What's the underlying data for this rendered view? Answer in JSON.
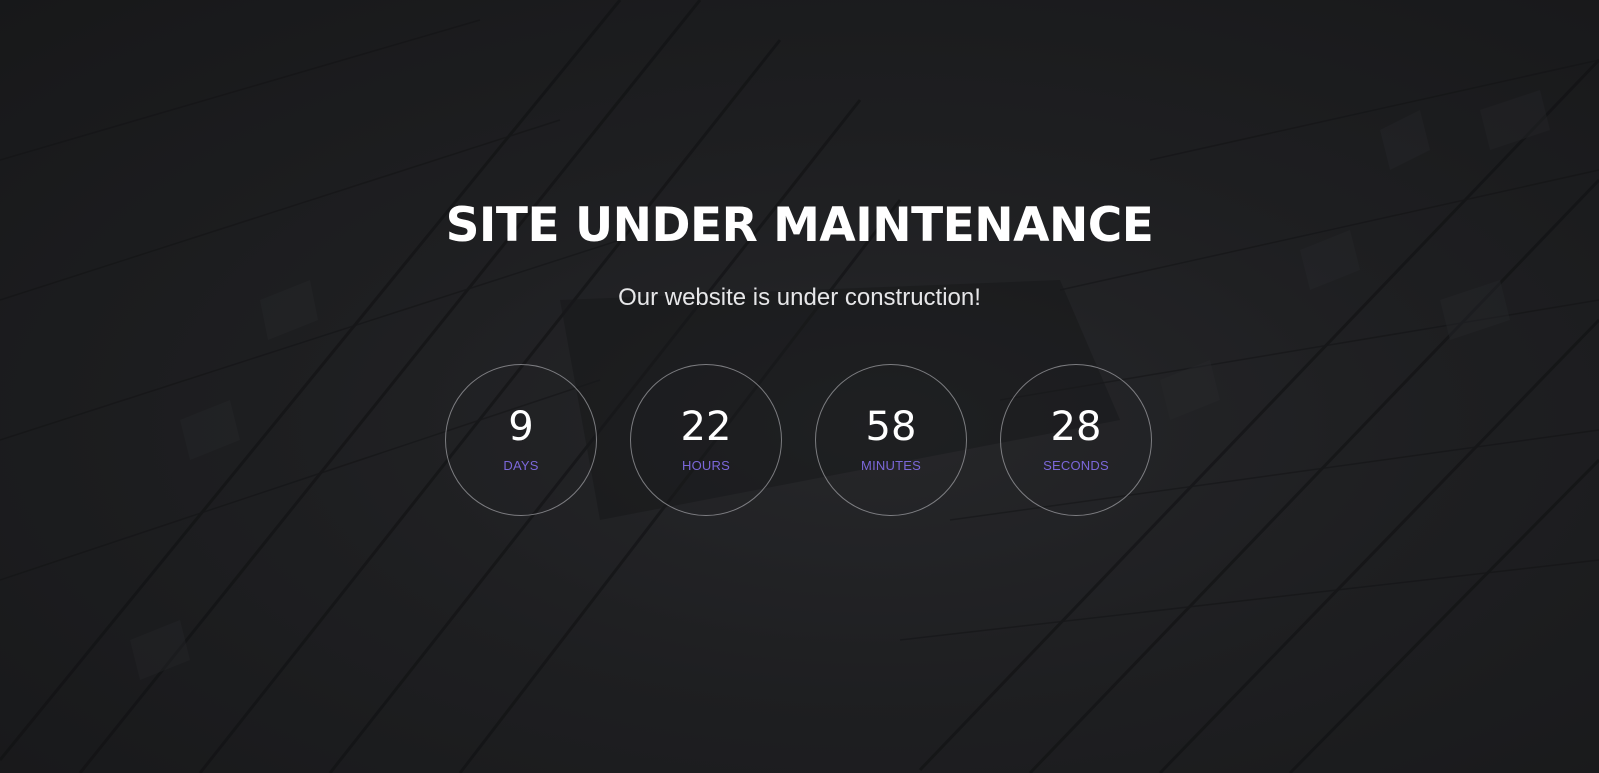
{
  "page": {
    "title": "SITE UNDER MAINTENANCE",
    "subtitle": "Our website is under construction!"
  },
  "countdown": {
    "days": {
      "value": "9",
      "label": "DAYS"
    },
    "hours": {
      "value": "22",
      "label": "HOURS"
    },
    "minutes": {
      "value": "58",
      "label": "MINUTES"
    },
    "seconds": {
      "value": "28",
      "label": "SECONDS"
    }
  },
  "colors": {
    "accent": "#7b67d9",
    "text": "#ffffff",
    "background": "#1f2022"
  }
}
